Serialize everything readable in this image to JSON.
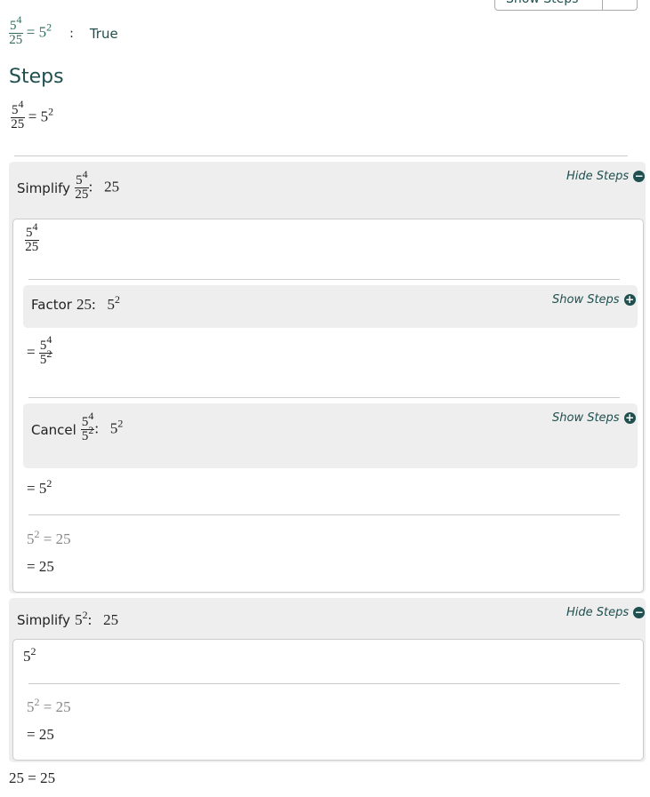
{
  "dropdown": {
    "label": "Show Steps"
  },
  "result": {
    "lhs_num": "5",
    "lhs_num_exp": "4",
    "lhs_den": "25",
    "rhs": "5",
    "rhs_exp": "2",
    "sep": ":",
    "verdict": "True"
  },
  "steps_title": "Steps",
  "equation": {
    "num": "5",
    "num_exp": "4",
    "den": "25",
    "rhs": "5",
    "rhs_exp": "2"
  },
  "simplify1": {
    "label": "Simplify",
    "num": "5",
    "num_exp": "4",
    "den": "25",
    "result": "25",
    "toggle": "Hide Steps",
    "start": {
      "num": "5",
      "num_exp": "4",
      "den": "25"
    },
    "factor": {
      "label": "Factor",
      "arg": "25",
      "result": "5",
      "result_exp": "2",
      "toggle": "Show Steps"
    },
    "after_factor": {
      "eq": "=",
      "num": "5",
      "num_exp": "4",
      "den": "5",
      "den_exp": "2"
    },
    "cancel": {
      "label": "Cancel",
      "num": "5",
      "num_exp": "4",
      "den": "5",
      "den_exp": "2",
      "result": "5",
      "result_exp": "2",
      "toggle": "Show Steps"
    },
    "after_cancel": {
      "eq": "=",
      "base": "5",
      "exp": "2"
    },
    "note": {
      "base": "5",
      "exp": "2",
      "rest": "= 25"
    },
    "final": "= 25"
  },
  "simplify2": {
    "label": "Simplify",
    "base": "5",
    "exp": "2",
    "result": "25",
    "toggle": "Hide Steps",
    "start": {
      "base": "5",
      "exp": "2"
    },
    "note": {
      "base": "5",
      "exp": "2",
      "rest": "= 25"
    },
    "final": "= 25"
  },
  "conclusion": "25 = 25"
}
